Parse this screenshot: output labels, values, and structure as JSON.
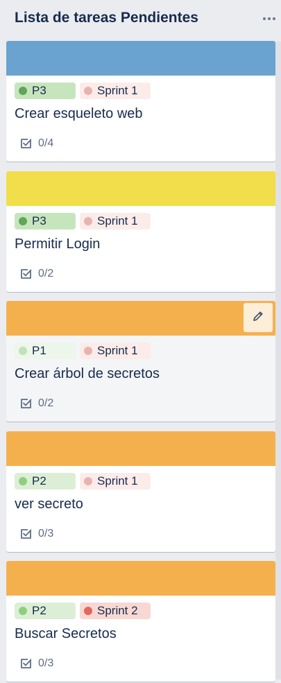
{
  "list": {
    "title": "Lista de tareas Pendientes",
    "menu_icon": "more-horizontal-icon"
  },
  "cards": [
    {
      "cover_color": "#6aa3cf",
      "priority": {
        "text": "P3",
        "bg": "#c7e5bd",
        "dot": "#5fa55a"
      },
      "sprint": {
        "text": "Sprint 1",
        "bg": "#fbecea",
        "dot": "#e8b3ad"
      },
      "title": "Crear esqueleto web",
      "checklist": "0/4",
      "show_edit": false
    },
    {
      "cover_color": "#f2dd4a",
      "priority": {
        "text": "P3",
        "bg": "#c7e5bd",
        "dot": "#5fa55a"
      },
      "sprint": {
        "text": "Sprint 1",
        "bg": "#fbecea",
        "dot": "#e8b3ad"
      },
      "title": "Permitir Login",
      "checklist": "0/2",
      "show_edit": false
    },
    {
      "cover_color": "#f5b04e",
      "priority": {
        "text": "P1",
        "bg": "#edf6ea",
        "dot": "#bfe2b6"
      },
      "sprint": {
        "text": "Sprint 1",
        "bg": "#fbecea",
        "dot": "#e8b3ad"
      },
      "title": "Crear árbol de secretos",
      "checklist": "0/2",
      "show_edit": true
    },
    {
      "cover_color": "#f5b04e",
      "priority": {
        "text": "P2",
        "bg": "#dcefd6",
        "dot": "#8dcf7e"
      },
      "sprint": {
        "text": "Sprint 1",
        "bg": "#fbecea",
        "dot": "#e8b3ad"
      },
      "title": "ver secreto",
      "checklist": "0/3",
      "show_edit": false
    },
    {
      "cover_color": "#f5b04e",
      "priority": {
        "text": "P2",
        "bg": "#dcefd6",
        "dot": "#8dcf7e"
      },
      "sprint": {
        "text": "Sprint 2",
        "bg": "#f7d8d3",
        "dot": "#e3675a"
      },
      "title": "Buscar Secretos",
      "checklist": "0/3",
      "show_edit": false
    }
  ]
}
